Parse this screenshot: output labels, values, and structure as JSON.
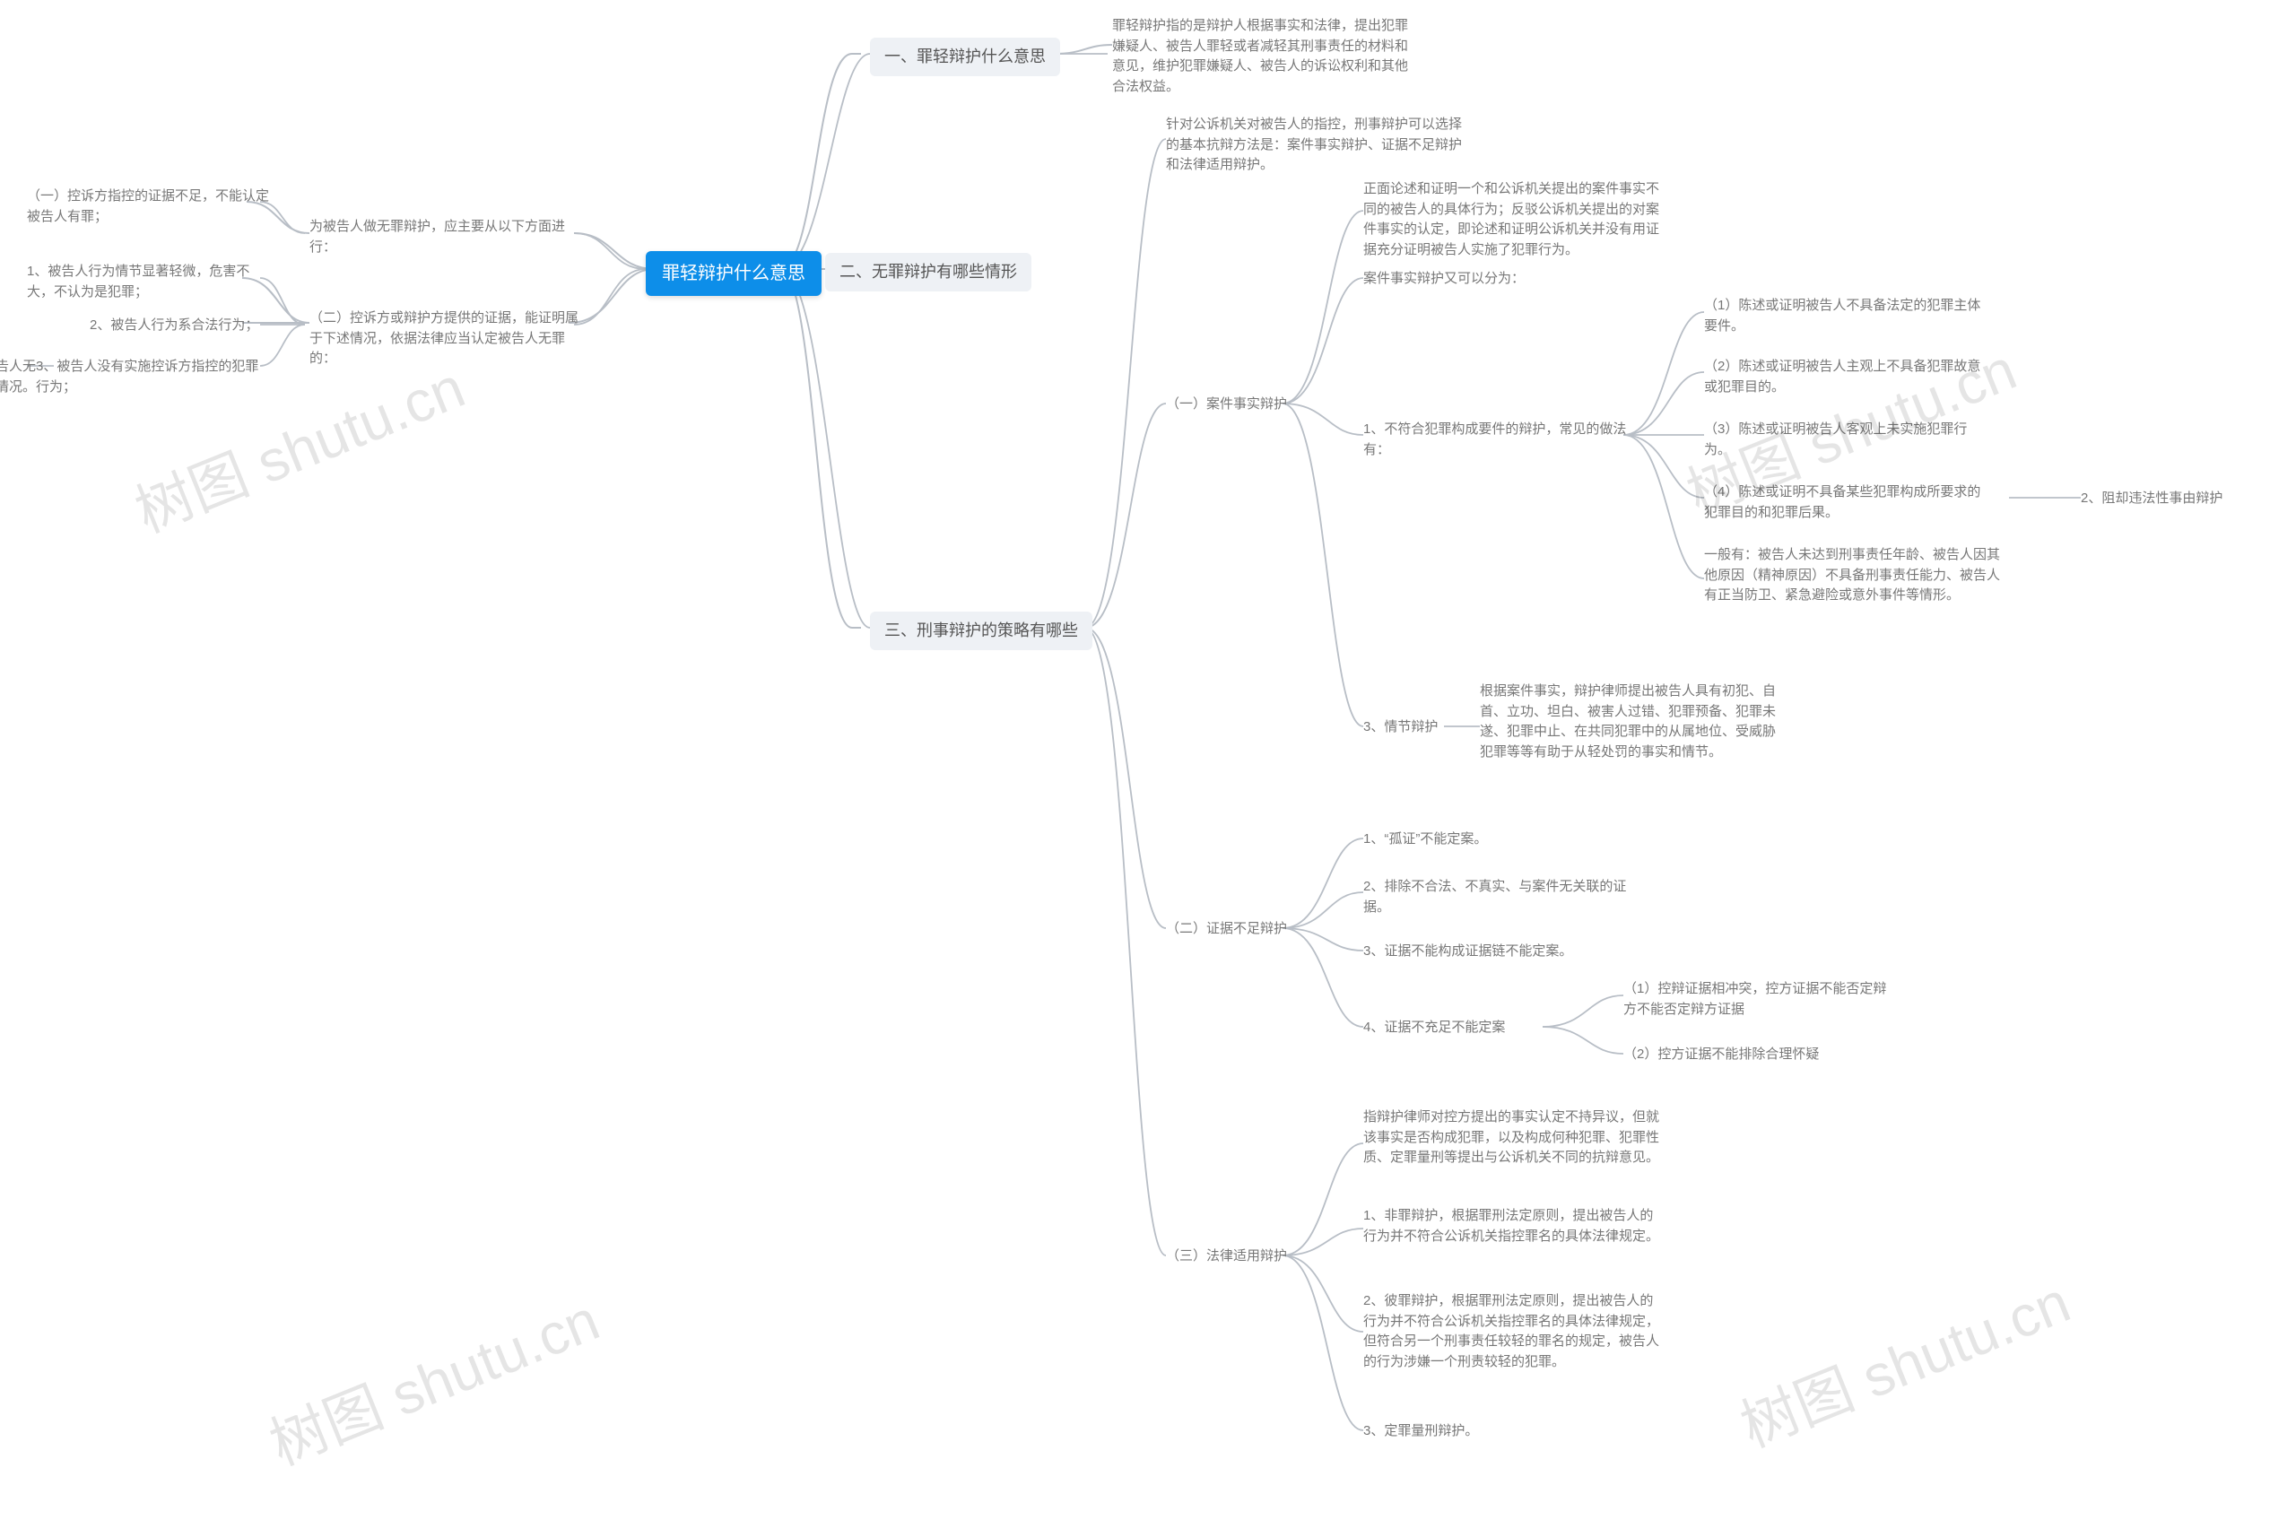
{
  "root": {
    "label": "罪轻辩护什么意思"
  },
  "b1": {
    "label": "一、罪轻辩护什么意思",
    "desc": "罪轻辩护指的是辩护人根据事实和法律，提出犯罪嫌疑人、被告人罪轻或者减轻其刑事责任的材料和意见，维护犯罪嫌疑人、被告人的诉讼权利和其他合法权益。"
  },
  "b2": {
    "label": "二、无罪辩护有哪些情形",
    "a": {
      "label": "为被告人做无罪辩护，应主要从以下方面进行：",
      "i1": "（一）控诉方指控的证据不足，不能认定被告人有罪；",
      "i2_label": "（二）控诉方或辩护方提供的证据，能证明属于下述情况，依据法律应当认定被告人无罪的：",
      "i2_s1": "1、被告人行为情节显著轻微，危害不大，不认为是犯罪；",
      "i2_s2": "2、被告人行为系合法行为；",
      "i2_s3": "3、被告人没有实施控诉方指控的犯罪行为；",
      "i3": "（三）其它依法认定被告人无罪的情况。"
    }
  },
  "b3": {
    "label": "三、刑事辩护的策略有哪些",
    "intro": "针对公诉机关对被告人的指控，刑事辩护可以选择的基本抗辩方法是：案件事实辩护、证据不足辩护和法律适用辩护。",
    "f1": {
      "label": "（一）案件事实辩护",
      "desc": "正面论述和证明一个和公诉机关提出的案件事实不同的被告人的具体行为；反驳公诉机关提出的对案件事实的认定，即论述和证明公诉机关并没有用证据充分证明被告人实施了犯罪行为。",
      "sub_label": "案件事实辩护又可以分为：",
      "s1_label": "1、不符合犯罪构成要件的辩护，常见的做法有：",
      "s1_a": "（1）陈述或证明被告人不具备法定的犯罪主体要件。",
      "s1_b": "（2）陈述或证明被告人主观上不具备犯罪故意或犯罪目的。",
      "s1_c": "（3）陈述或证明被告人客观上未实施犯罪行为。",
      "s1_d": "（4）陈述或证明不具备某些犯罪构成所要求的犯罪目的和犯罪后果。",
      "s1_more": "一般有：被告人未达到刑事责任年龄、被告人因其他原因（精神原因）不具备刑事责任能力、被告人有正当防卫、紧急避险或意外事件等情形。",
      "s2": "2、阻却违法性事由辩护",
      "s3_label": "3、情节辩护",
      "s3_desc": "根据案件事实，辩护律师提出被告人具有初犯、自首、立功、坦白、被害人过错、犯罪预备、犯罪未遂、犯罪中止、在共同犯罪中的从属地位、受威胁犯罪等等有助于从轻处罚的事实和情节。"
    },
    "f2": {
      "label": "（二）证据不足辩护",
      "i1": "1、“孤证”不能定案。",
      "i2": "2、排除不合法、不真实、与案件无关联的证据。",
      "i3": "3、证据不能构成证据链不能定案。",
      "i4_label": "4、证据不充足不能定案",
      "i4_a": "（1）控辩证据相冲突，控方证据不能否定辩方不能否定辩方证据",
      "i4_b": "（2）控方证据不能排除合理怀疑"
    },
    "f3": {
      "label": "（三）法律适用辩护",
      "desc": "指辩护律师对控方提出的事实认定不持异议，但就该事实是否构成犯罪，以及构成何种犯罪、犯罪性质、定罪量刑等提出与公诉机关不同的抗辩意见。",
      "i1": "1、非罪辩护，根据罪刑法定原则，提出被告人的行为并不符合公诉机关指控罪名的具体法律规定。",
      "i2": "2、彼罪辩护，根据罪刑法定原则，提出被告人的行为并不符合公诉机关指控罪名的具体法律规定，但符合另一个刑事责任较轻的罪名的规定，被告人的行为涉嫌一个刑责较轻的犯罪。",
      "i3": "3、定罪量刑辩护。"
    }
  },
  "watermark": "树图 shutu.cn"
}
